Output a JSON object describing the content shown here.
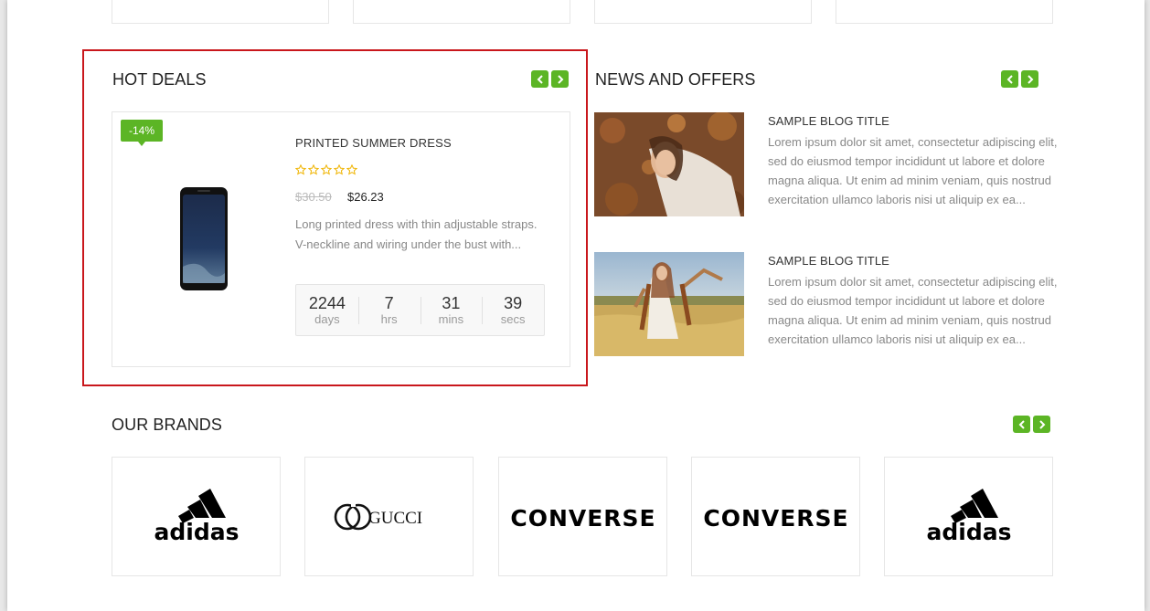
{
  "hot_deals": {
    "title": "HOT DEALS",
    "discount_badge": "-14%",
    "product": {
      "name": "PRINTED SUMMER DRESS",
      "rating_stars": 5,
      "rating_filled": 0,
      "old_price": "$30.50",
      "new_price": "$26.23",
      "description": "Long printed dress with thin adjustable straps. V-neckline and wiring under the bust with..."
    },
    "countdown": [
      {
        "value": "2244",
        "label": "days"
      },
      {
        "value": "7",
        "label": "hrs"
      },
      {
        "value": "31",
        "label": "mins"
      },
      {
        "value": "39",
        "label": "secs"
      }
    ]
  },
  "news": {
    "title": "NEWS AND OFFERS",
    "posts": [
      {
        "title": "SAMPLE BLOG TITLE",
        "text": "Lorem ipsum dolor sit amet, consectetur adipiscing elit, sed do eiusmod tempor incididunt ut labore et dolore magna aliqua. Ut enim ad minim veniam, quis nostrud exercitation ullamco laboris nisi ut aliquip ex ea..."
      },
      {
        "title": "SAMPLE BLOG TITLE",
        "text": "Lorem ipsum dolor sit amet, consectetur adipiscing elit, sed do eiusmod tempor incididunt ut labore et dolore magna aliqua. Ut enim ad minim veniam, quis nostrud exercitation ullamco laboris nisi ut aliquip ex ea..."
      }
    ]
  },
  "brands": {
    "title": "OUR BRANDS",
    "items": [
      "adidas",
      "GUCCI",
      "CONVERSE",
      "CONVERSE",
      "adidas"
    ]
  },
  "colors": {
    "accent_green": "#5cb525",
    "highlight_red": "#c9171c",
    "star_yellow": "#f0b400"
  }
}
